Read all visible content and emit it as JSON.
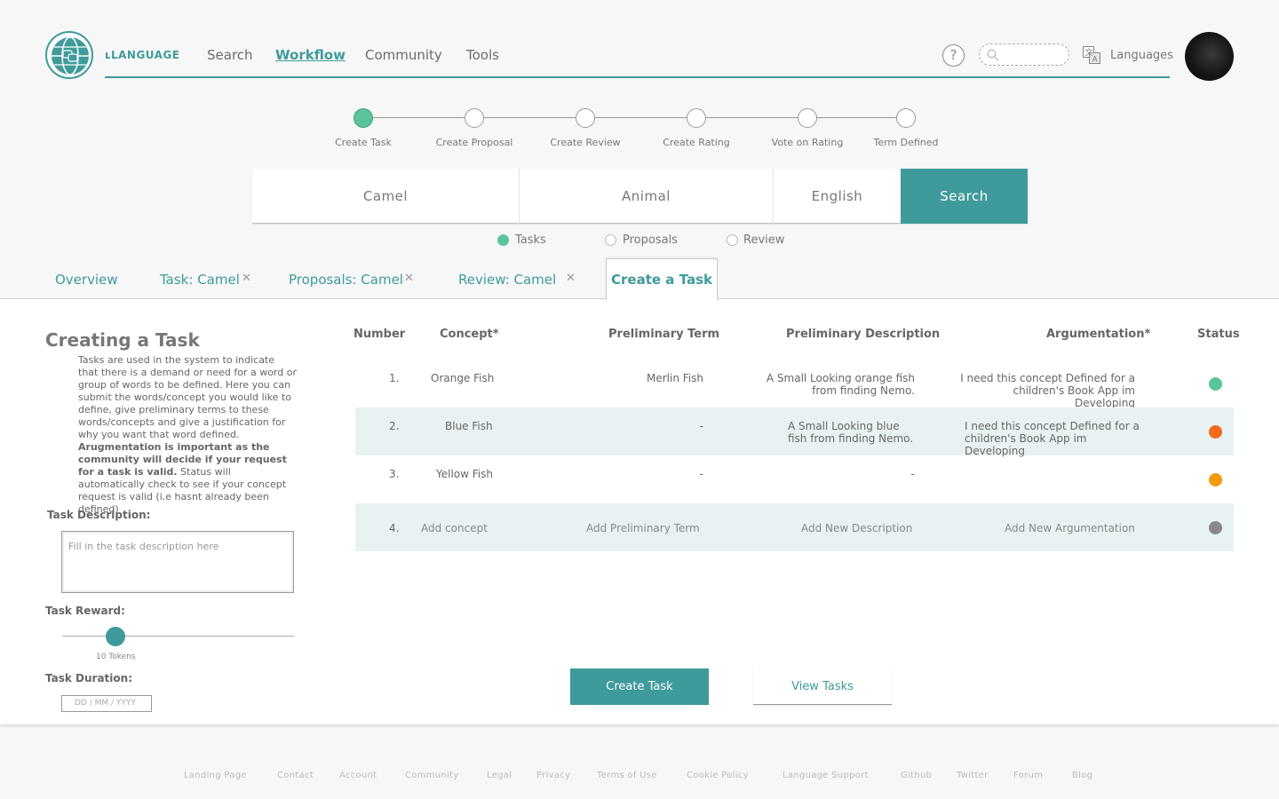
{
  "brand": "ʟLANGUAGE",
  "nav": [
    "Search",
    "Workflow",
    "Community",
    "Tools"
  ],
  "header": {
    "languages_label": "Languages"
  },
  "steps": [
    "Create Task",
    "Create Proposal",
    "Create Review",
    "Create Rating",
    "Vote on Rating",
    "Term Defined"
  ],
  "search": {
    "concept": "Camel",
    "category": "Animal",
    "language": "English",
    "button": "Search"
  },
  "filters": [
    "Tasks",
    "Proposals",
    "Review"
  ],
  "tabs": [
    "Overview",
    "Task: Camel",
    "Proposals: Camel",
    "Review: Camel",
    "Create a Task"
  ],
  "panel": {
    "title": "Creating a Task",
    "intro_1": "Tasks are used in the system to indicate that there is a demand or need for a word or group of words to be defined. Here you can submit the words/concept you would like to define, give preliminary terms to  these words/concepts and give a justification for why you want that word defined. ",
    "intro_bold": "Arugmentation is important as the community will decide if your request for a task is valid.",
    "intro_2": "  Status will automatically check to see if your concept request is valid (i.e hasnt already been defined)",
    "task_description_label": "Task Description:",
    "task_description_placeholder": "Fill in the task description here",
    "task_reward_label": "Task Reward:",
    "task_reward_value": "10 Tokens",
    "task_duration_label": "Task Duration:",
    "task_duration_placeholder": "DD / MM / YYYY"
  },
  "table": {
    "headers": [
      "Number",
      "Concept*",
      "Preliminary Term",
      "Preliminary Description",
      "Argumentation*",
      "Status"
    ],
    "rows": [
      {
        "number": "1.",
        "concept": "Orange Fish",
        "term": "Merlin Fish",
        "description": "A Small Looking orange fish from finding Nemo.",
        "argumentation": "I need this concept Defined for a children's Book App im Developing",
        "status_color": "#5cc49a"
      },
      {
        "number": "2.",
        "concept": "Blue Fish",
        "term": "-",
        "description": "A Small Looking blue fish from finding Nemo.",
        "argumentation": "I need this concept Defined for a children's Book App im Developing",
        "status_color": "#f26a1b"
      },
      {
        "number": "3.",
        "concept": "Yellow Fish",
        "term": "-",
        "description": "-",
        "argumentation": "",
        "status_color": "#f29a10"
      },
      {
        "number": "4.",
        "concept": "Add concept",
        "term": "Add Preliminary Term",
        "description": "Add New Description",
        "argumentation": "Add New Argumentation",
        "status_color": "#888888"
      }
    ]
  },
  "actions": {
    "create": "Create Task",
    "view": "View Tasks"
  },
  "footer": [
    "Landing Page",
    "Contact",
    "Account",
    "Community",
    "Legal",
    "Privacy",
    "Terms of Use",
    "Cookie Policy",
    "Language Support",
    "Github",
    "Twitter",
    "Forum",
    "Blog"
  ],
  "colors": {
    "accent": "#3f9a9b",
    "step_done": "#5cc49a",
    "row_highlight": "#e8f2f3"
  },
  "icons": [
    "globe-logo-icon",
    "help-icon",
    "search-icon",
    "translate-icon",
    "close-icon"
  ]
}
